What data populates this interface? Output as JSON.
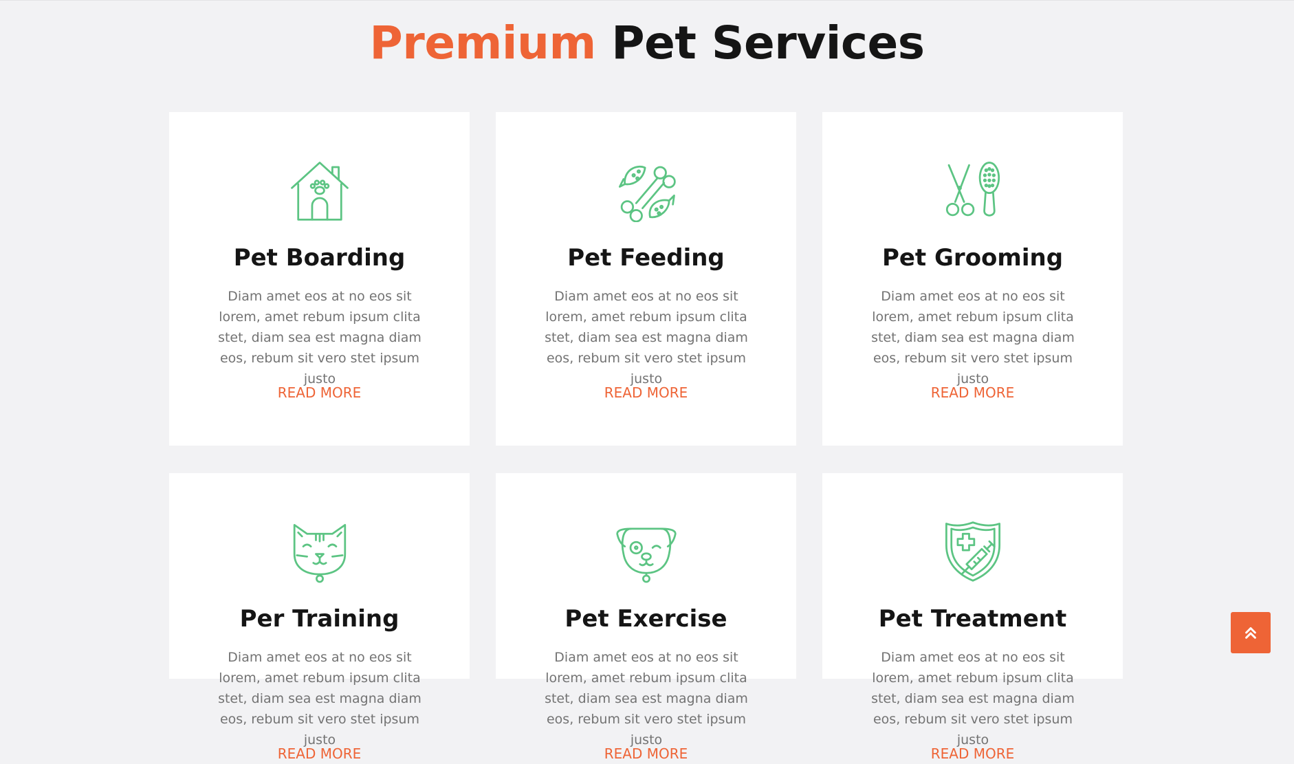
{
  "section": {
    "title_accent": "Premium",
    "title_rest": "Pet Services"
  },
  "colors": {
    "accent": "#ee6436",
    "icon": "#5cc483",
    "background": "#f2f2f4",
    "card": "#ffffff"
  },
  "services": [
    {
      "icon": "dog-house-icon",
      "title": "Pet Boarding",
      "text": "Diam amet eos at no eos sit lorem, amet rebum ipsum clita stet, diam sea est magna diam eos, rebum sit vero stet ipsum justo",
      "link": "READ MORE"
    },
    {
      "icon": "bone-fish-icon",
      "title": "Pet Feeding",
      "text": "Diam amet eos at no eos sit lorem, amet rebum ipsum clita stet, diam sea est magna diam eos, rebum sit vero stet ipsum justo",
      "link": "READ MORE"
    },
    {
      "icon": "scissors-brush-icon",
      "title": "Pet Grooming",
      "text": "Diam amet eos at no eos sit lorem, amet rebum ipsum clita stet, diam sea est magna diam eos, rebum sit vero stet ipsum justo",
      "link": "READ MORE"
    },
    {
      "icon": "cat-face-icon",
      "title": "Per Training",
      "text": "Diam amet eos at no eos sit lorem, amet rebum ipsum clita stet, diam sea est magna diam eos, rebum sit vero stet ipsum justo",
      "link": "READ MORE"
    },
    {
      "icon": "dog-face-icon",
      "title": "Pet Exercise",
      "text": "Diam amet eos at no eos sit lorem, amet rebum ipsum clita stet, diam sea est magna diam eos, rebum sit vero stet ipsum justo",
      "link": "READ MORE"
    },
    {
      "icon": "shield-syringe-icon",
      "title": "Pet Treatment",
      "text": "Diam amet eos at no eos sit lorem, amet rebum ipsum clita stet, diam sea est magna diam eos, rebum sit vero stet ipsum justo",
      "link": "READ MORE"
    }
  ],
  "back_to_top": {
    "icon": "double-chevron-up-icon"
  }
}
